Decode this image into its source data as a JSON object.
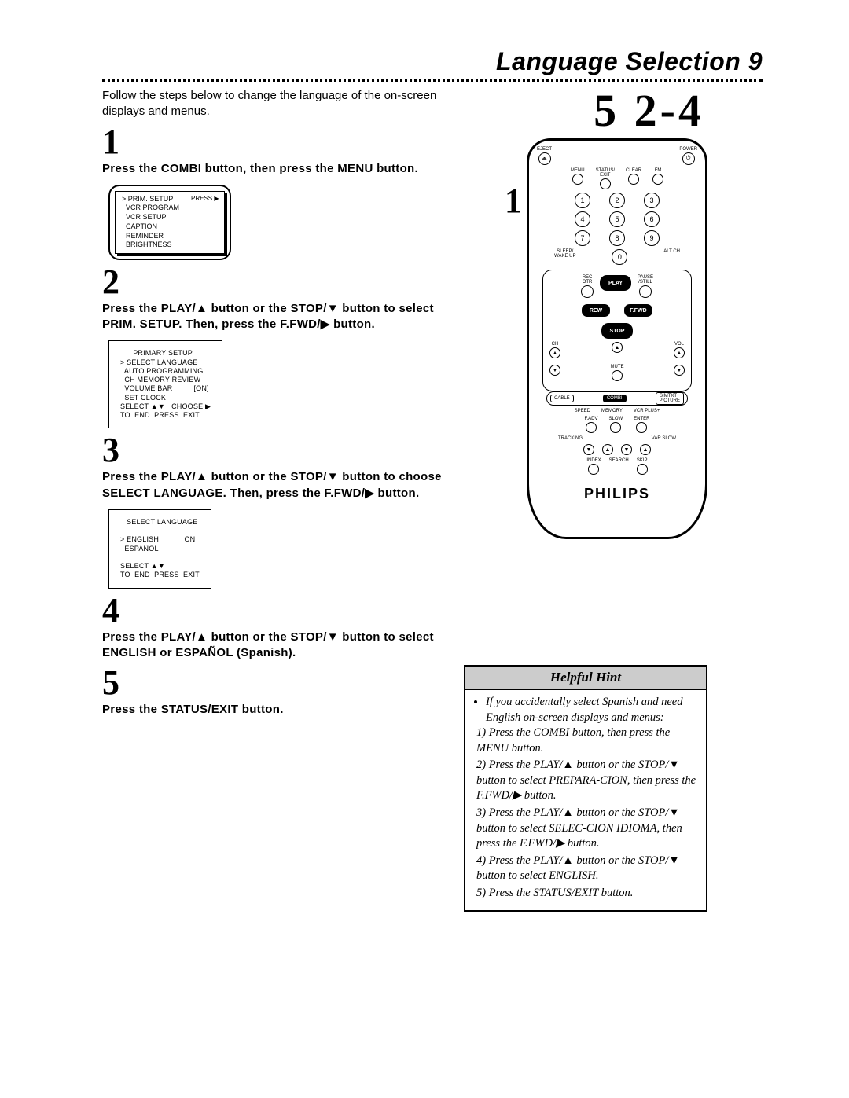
{
  "header": {
    "title": "Language Selection  9"
  },
  "intro": "Follow the steps below to change the language of the on-screen displays and menus.",
  "callouts": {
    "top_right": "5 2-4",
    "left_label": "1"
  },
  "steps": {
    "s1": {
      "num": "1",
      "text": "Press the COMBI button, then press the MENU button."
    },
    "s2": {
      "num": "2",
      "text": "Press the PLAY/▲ button or the STOP/▼ button to select PRIM. SETUP. Then, press the F.FWD/▶ button."
    },
    "s3": {
      "num": "3",
      "text": "Press the PLAY/▲ button or the STOP/▼ button to choose SELECT LANGUAGE. Then, press the F.FWD/▶ button."
    },
    "s4": {
      "num": "4",
      "text": "Press the PLAY/▲ button or the STOP/▼ button to select ENGLISH or ESPAÑOL (Spanish)."
    },
    "s5": {
      "num": "5",
      "text": "Press the STATUS/EXIT button."
    }
  },
  "osd1": {
    "left_lines": "> PRIM. SETUP\n  VCR PROGRAM\n  VCR SETUP\n  CAPTION\n  REMINDER\n  BRIGHTNESS",
    "right_label": "PRESS ▶"
  },
  "osd2": "      PRIMARY SETUP\n> SELECT LANGUAGE\n  AUTO PROGRAMMING\n  CH MEMORY REVIEW\n  VOLUME BAR          [ON]\n  SET CLOCK\nSELECT ▲▼   CHOOSE ▶\nTO  END  PRESS  EXIT",
  "osd3": "   SELECT LANGUAGE\n\n> ENGLISH            ON\n  ESPAÑOL\n\nSELECT ▲▼\nTO  END  PRESS  EXIT",
  "remote": {
    "eject": "EJECT",
    "power": "POWER",
    "row2": {
      "menu": "MENU",
      "status": "STATUS/\nEXIT",
      "clear": "CLEAR",
      "fm": "FM"
    },
    "digits": [
      "1",
      "2",
      "3",
      "4",
      "5",
      "6",
      "7",
      "8",
      "9",
      "0"
    ],
    "sleep": "SLEEP/\nWAKE UP",
    "altch": "ALT CH",
    "rec": "REC\nOTR",
    "play": "PLAY",
    "pause": "PAUSE\n/STILL",
    "rew": "REW",
    "ffwd": "F.FWD",
    "stop": "STOP",
    "ch": "CH",
    "mute": "MUTE",
    "vol": "VOL",
    "cable": "CABLE",
    "combi": "COMBI",
    "simtxt": "SIMTXT+\nPICTURE",
    "speed": "SPEED",
    "memory": "MEMORY",
    "vcrplus": "VCR PLUS+",
    "fadv": "F.ADV",
    "slow": "SLOW",
    "enter": "ENTER",
    "tracking": "TRACKING",
    "varslow": "VAR.SLOW",
    "index": "INDEX",
    "search": "SEARCH",
    "skip": "SKIP",
    "logo": "PHILIPS"
  },
  "hint": {
    "title": "Helpful Hint",
    "bullet": "If you accidentally select Spanish and need English on-screen displays and menus:",
    "l1": "1) Press the COMBI button, then press the MENU button.",
    "l2": "2) Press the PLAY/▲ button or the STOP/▼ button to select PREPARA-CION, then press the F.FWD/▶ button.",
    "l3": "3) Press the PLAY/▲ button or the STOP/▼ button to select SELEC-CION IDIOMA, then press the F.FWD/▶ button.",
    "l4": "4) Press the PLAY/▲ button or the STOP/▼ button to select ENGLISH.",
    "l5": "5) Press the STATUS/EXIT button."
  }
}
